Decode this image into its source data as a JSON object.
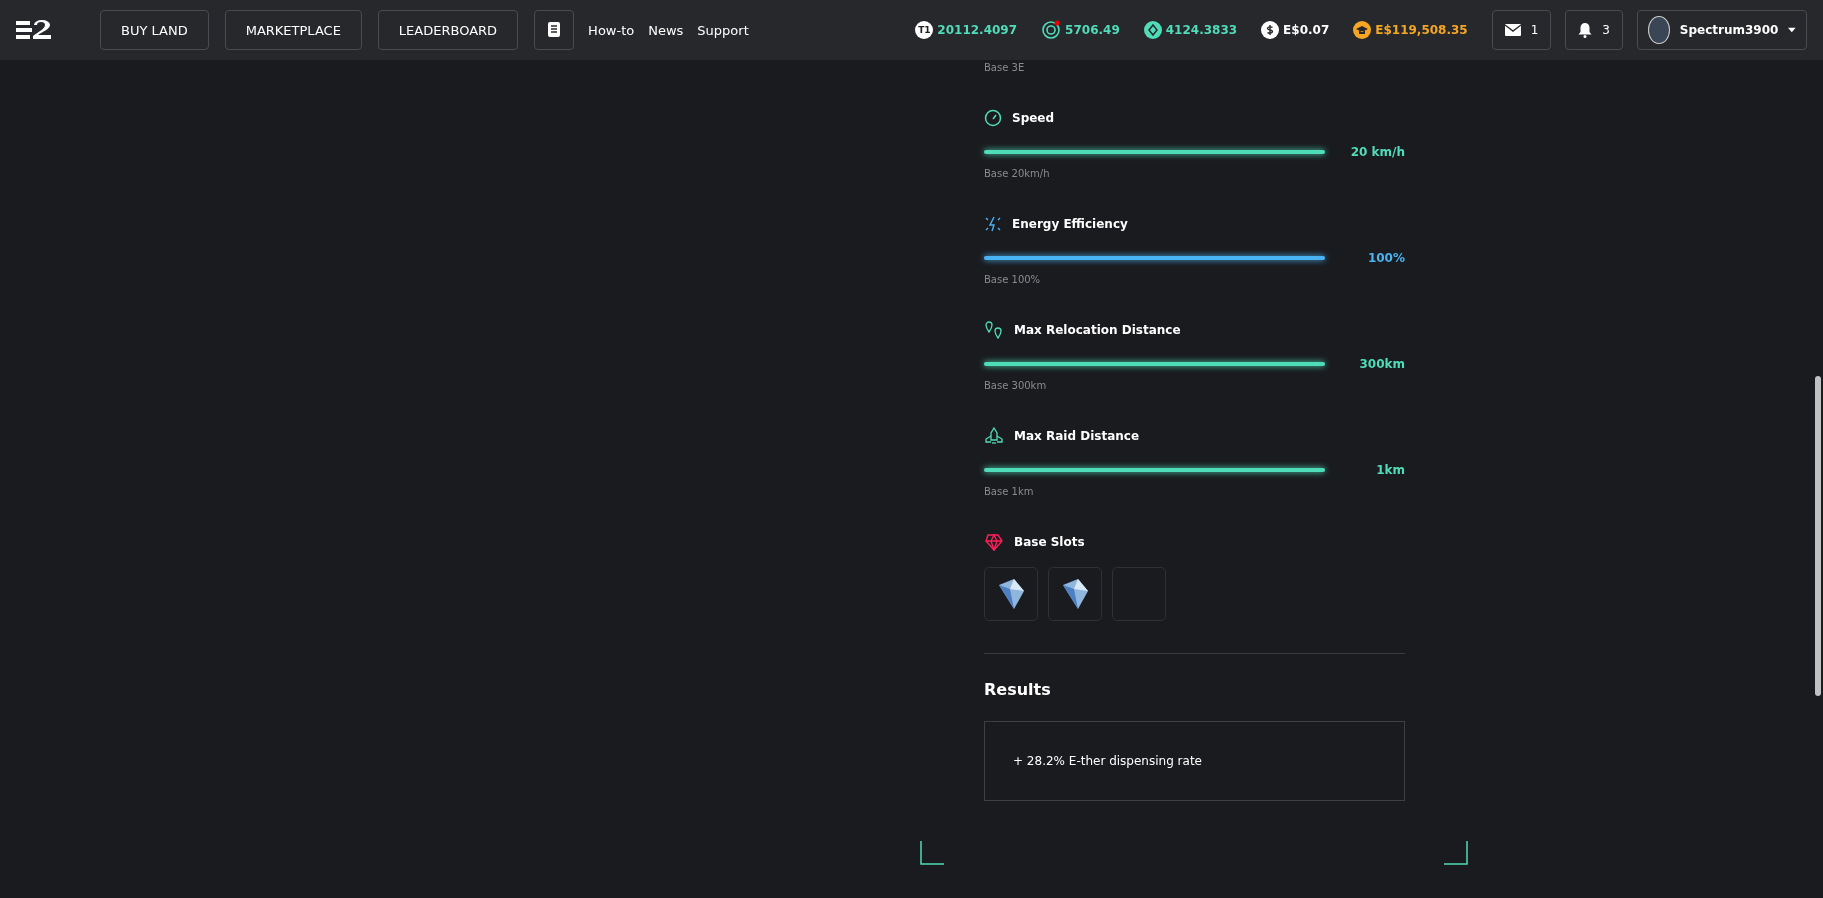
{
  "nav": {
    "buttons": [
      "BUY LAND",
      "MARKETPLACE",
      "LEADERBOARD"
    ],
    "links": [
      "How-to",
      "News",
      "Support"
    ]
  },
  "balances": [
    {
      "kind": "tier",
      "icon_text": "T1",
      "value": "20112.4097",
      "color": "#4fdcb8"
    },
    {
      "kind": "target",
      "value": "5706.49",
      "color": "#4fdcb8"
    },
    {
      "kind": "diamond",
      "value": "4124.3833",
      "color": "#4fdcb8"
    },
    {
      "kind": "dollar",
      "value": "E$0.07",
      "color": "#ffffff"
    },
    {
      "kind": "cap",
      "value": "E$119,508.35",
      "color": "#f5a623"
    }
  ],
  "mail": {
    "count": "1"
  },
  "notifications": {
    "count": "3"
  },
  "user": {
    "name": "Spectrum3900"
  },
  "top_note": "Base 3E",
  "stats": [
    {
      "kind": "speed",
      "title": "Speed",
      "level": 1,
      "value": "20 km/h",
      "base": "Base 20km/h",
      "color": "#4fdcb8"
    },
    {
      "kind": "energy",
      "title": "Energy Efficiency",
      "level": 1,
      "value": "100%",
      "base": "Base 100%",
      "color": "#4ab3f4"
    },
    {
      "kind": "relocation",
      "title": "Max Relocation Distance",
      "level": 1,
      "value": "300km",
      "base": "Base 300km",
      "color": "#4fdcb8"
    },
    {
      "kind": "raid",
      "title": "Max Raid Distance",
      "level": 1,
      "value": "1km",
      "base": "Base 1km",
      "color": "#4fdcb8"
    }
  ],
  "base_slots": {
    "title": "Base Slots",
    "slots": [
      {
        "filled": true
      },
      {
        "filled": true
      },
      {
        "filled": false
      }
    ]
  },
  "results": {
    "title": "Results",
    "items": [
      "+ 28.2% E-ther dispensing rate"
    ]
  }
}
